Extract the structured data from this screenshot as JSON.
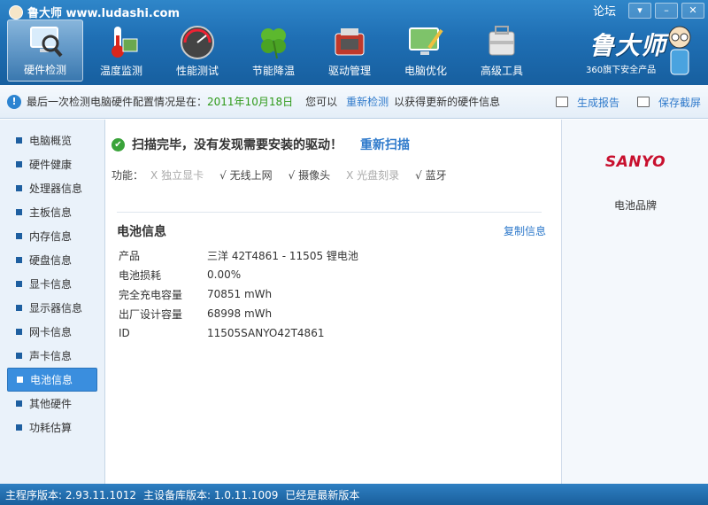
{
  "window": {
    "title": "鲁大师 www.ludashi.com",
    "forum": "论坛",
    "controls": [
      "▾",
      "–",
      "✕"
    ]
  },
  "tabs": [
    {
      "label": "硬件检测",
      "icon": "monitor-magnifier-icon",
      "active": true
    },
    {
      "label": "温度监测",
      "icon": "thermometer-icon",
      "active": false
    },
    {
      "label": "性能测试",
      "icon": "speedometer-icon",
      "active": false
    },
    {
      "label": "节能降温",
      "icon": "clover-icon",
      "active": false
    },
    {
      "label": "驱动管理",
      "icon": "toolbox-icon",
      "active": false
    },
    {
      "label": "电脑优化",
      "icon": "monitor-brush-icon",
      "active": false
    },
    {
      "label": "高级工具",
      "icon": "toolkit-icon",
      "active": false
    }
  ],
  "brand": {
    "name": "鲁大师",
    "subtitle": "360旗下安全产品"
  },
  "infobar": {
    "prefix": "最后一次检测电脑硬件配置情况是在：",
    "date": "2011年10月18日",
    "mid": "您可以",
    "redetect": "重新检测",
    "suffix": "以获得更新的硬件信息",
    "report": "生成报告",
    "screenshot": "保存截屏"
  },
  "sidebar": {
    "items": [
      {
        "label": "电脑概览"
      },
      {
        "label": "硬件健康"
      },
      {
        "label": "处理器信息"
      },
      {
        "label": "主板信息"
      },
      {
        "label": "内存信息"
      },
      {
        "label": "硬盘信息"
      },
      {
        "label": "显卡信息"
      },
      {
        "label": "显示器信息"
      },
      {
        "label": "网卡信息"
      },
      {
        "label": "声卡信息"
      },
      {
        "label": "电池信息",
        "active": true
      },
      {
        "label": "其他硬件"
      },
      {
        "label": "功耗估算"
      }
    ]
  },
  "main": {
    "scan_message": "扫描完毕，没有发现需要安装的驱动！",
    "rescan": "重新扫描",
    "features_label": "功能：",
    "features": [
      {
        "mark": "X",
        "label": "独立显卡",
        "enabled": false
      },
      {
        "mark": "√",
        "label": "无线上网",
        "enabled": true
      },
      {
        "mark": "√",
        "label": "摄像头",
        "enabled": true
      },
      {
        "mark": "X",
        "label": "光盘刻录",
        "enabled": false
      },
      {
        "mark": "√",
        "label": "蓝牙",
        "enabled": true
      }
    ],
    "section_title": "电池信息",
    "copy_info": "复制信息",
    "properties": [
      {
        "key": "产品",
        "value": "三洋 42T4861 - 11505 锂电池"
      },
      {
        "key": "电池损耗",
        "value": "0.00%"
      },
      {
        "key": "完全充电容量",
        "value": "70851 mWh"
      },
      {
        "key": "出厂设计容量",
        "value": "68998 mWh"
      },
      {
        "key": "ID",
        "value": "11505SANYO42T4861"
      }
    ]
  },
  "right_panel": {
    "logo_text": "SANYO",
    "brand_label": "电池品牌"
  },
  "status": {
    "program_version": "主程序版本: 2.93.11.1012",
    "db_version": "主设备库版本: 1.0.11.1009",
    "latest": "已经是最新版本"
  }
}
